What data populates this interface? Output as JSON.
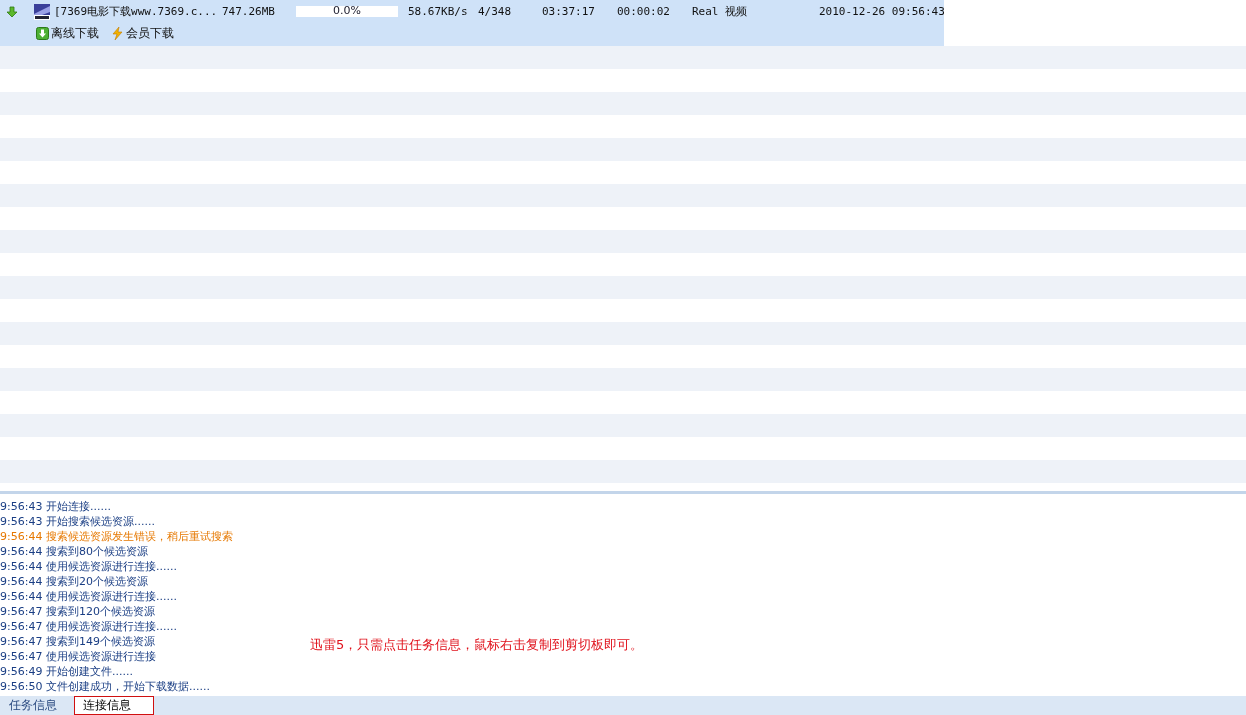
{
  "task": {
    "name": "[7369电影下载www.7369.c...",
    "size": "747.26MB",
    "progress": {
      "level": 0.0,
      "text": "0.0%"
    },
    "speed": "58.67KB/s",
    "sources": "4/348",
    "remaining": "03:37:17",
    "elapsed": "00:00:02",
    "type": "Real 视频",
    "created": "2010-12-26 09:56:43",
    "actions": [
      {
        "kind": "offline",
        "label": "离线下载"
      },
      {
        "kind": "vip",
        "label": "会员下载"
      }
    ]
  },
  "log": [
    {
      "time": "9:56:43",
      "text": "开始连接......",
      "kind": "info"
    },
    {
      "time": "9:56:43",
      "text": "开始搜索候选资源......",
      "kind": "info"
    },
    {
      "time": "9:56:44",
      "text": "搜索候选资源发生错误，稍后重试搜索",
      "kind": "error"
    },
    {
      "time": "9:56:44",
      "text": "搜索到80个候选资源",
      "kind": "info"
    },
    {
      "time": "9:56:44",
      "text": "使用候选资源进行连接......",
      "kind": "info"
    },
    {
      "time": "9:56:44",
      "text": "搜索到20个候选资源",
      "kind": "info"
    },
    {
      "time": "9:56:44",
      "text": "使用候选资源进行连接......",
      "kind": "info"
    },
    {
      "time": "9:56:47",
      "text": "搜索到120个候选资源",
      "kind": "info"
    },
    {
      "time": "9:56:47",
      "text": "使用候选资源进行连接......",
      "kind": "info"
    },
    {
      "time": "9:56:47",
      "text": "搜索到149个候选资源",
      "kind": "info"
    },
    {
      "time": "9:56:47",
      "text": "使用候选资源进行连接",
      "kind": "info"
    },
    {
      "time": "9:56:49",
      "text": "开始创建文件......",
      "kind": "info"
    },
    {
      "time": "9:56:50",
      "text": "文件创建成功，开始下载数据......",
      "kind": "info"
    }
  ],
  "annotation": "迅雷5，只需点击任务信息，鼠标右击复制到剪切板即可。",
  "tabs": [
    {
      "label": "任务信息",
      "selected": false
    },
    {
      "label": "连接信息",
      "selected": true
    }
  ]
}
